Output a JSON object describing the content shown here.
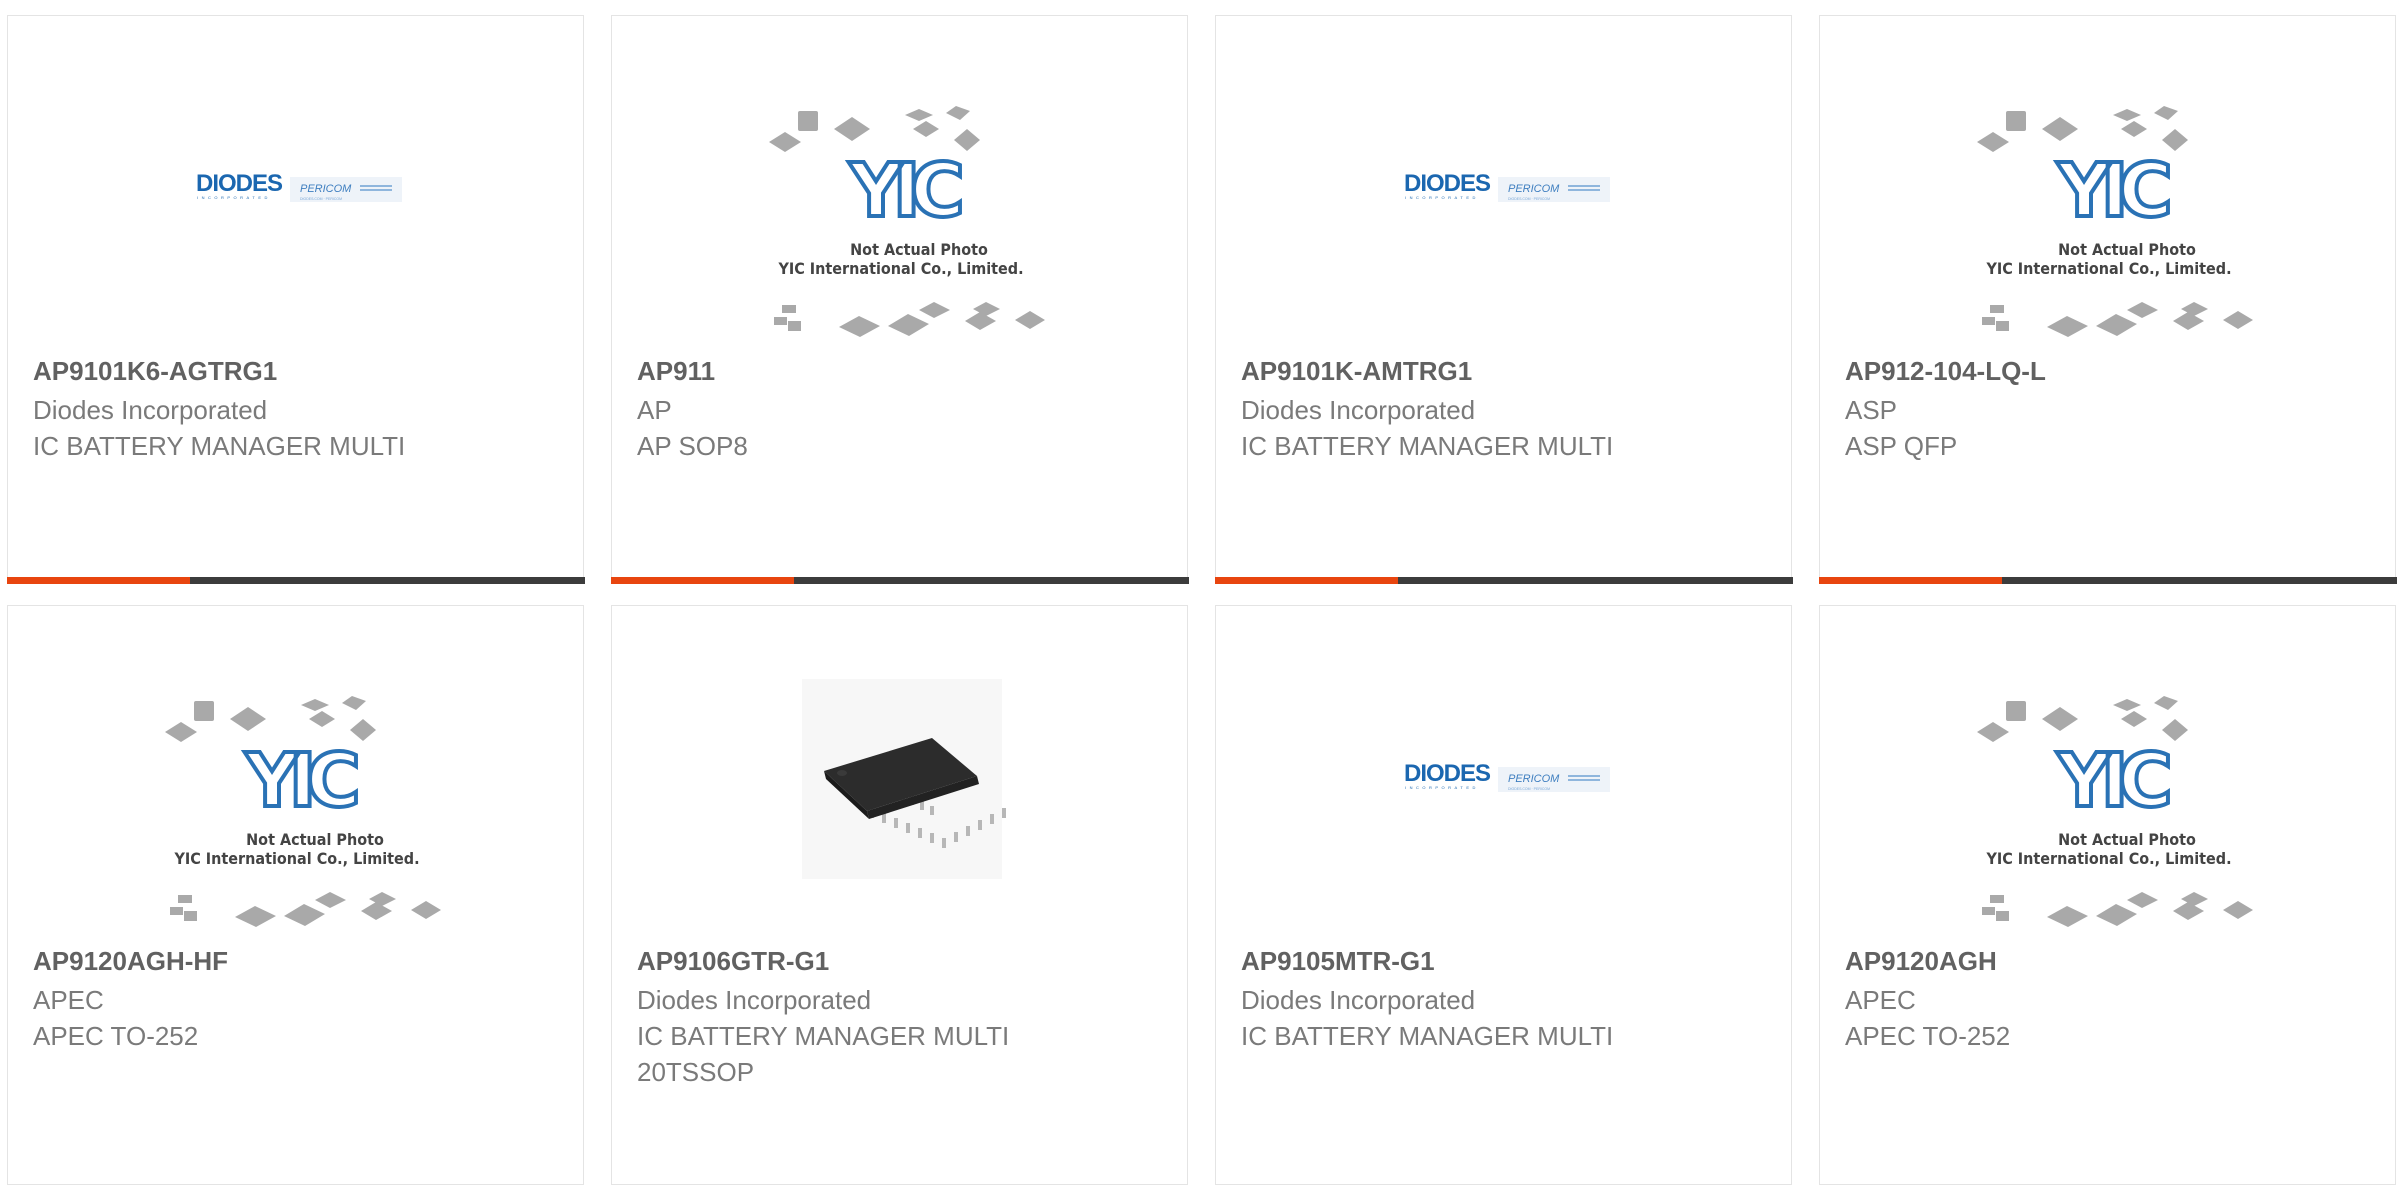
{
  "products": [
    {
      "part": "AP9101K6-AGTRG1",
      "manufacturer": "Diodes Incorporated",
      "description": "IC BATTERY MANAGER MULTI",
      "description2": "",
      "image": "diodes-logo"
    },
    {
      "part": "AP911",
      "manufacturer": "AP",
      "description": "AP SOP8",
      "description2": "",
      "image": "yic-placeholder"
    },
    {
      "part": "AP9101K-AMTRG1",
      "manufacturer": "Diodes Incorporated",
      "description": "IC BATTERY MANAGER MULTI",
      "description2": "",
      "image": "diodes-logo"
    },
    {
      "part": "AP912-104-LQ-L",
      "manufacturer": "ASP",
      "description": "ASP QFP",
      "description2": "",
      "image": "yic-placeholder"
    },
    {
      "part": "AP9120AGH-HF",
      "manufacturer": "APEC",
      "description": "APEC TO-252",
      "description2": "",
      "image": "yic-placeholder"
    },
    {
      "part": "AP9106GTR-G1",
      "manufacturer": "Diodes Incorporated",
      "description": "IC BATTERY MANAGER MULTI",
      "description2": "20TSSOP",
      "image": "chip-photo"
    },
    {
      "part": "AP9105MTR-G1",
      "manufacturer": "Diodes Incorporated",
      "description": "IC BATTERY MANAGER MULTI",
      "description2": "",
      "image": "diodes-logo"
    },
    {
      "part": "AP9120AGH",
      "manufacturer": "APEC",
      "description": "APEC TO-252",
      "description2": "",
      "image": "yic-placeholder"
    }
  ],
  "diodes_logo": {
    "brand": "DIODES",
    "sub": "INCORPORATED",
    "brand2": "PERICOM",
    "tagline": "DIODES.COM · PERICOM"
  },
  "yic_placeholder": {
    "logo": "YIC",
    "line1": "Not Actual Photo",
    "line2": "YIC International Co., Limited."
  },
  "colors": {
    "accent": "#e8450f",
    "bar": "#3c3c3c",
    "title": "#616161",
    "text": "#7a7a7a",
    "border": "#e4e4e4",
    "logo_blue": "#1b67b0"
  }
}
